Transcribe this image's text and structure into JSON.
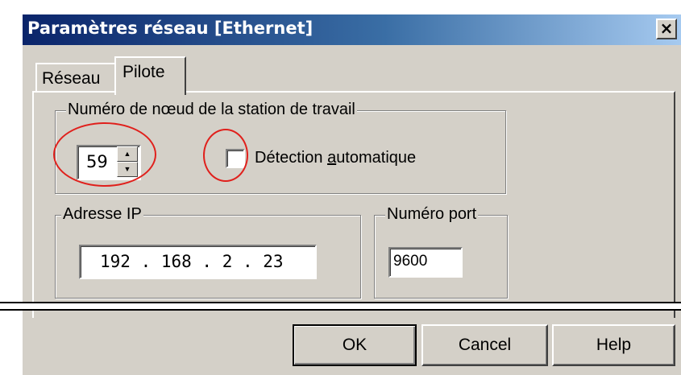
{
  "window": {
    "title": "Paramètres réseau [Ethernet]",
    "close_glyph": "×"
  },
  "tabs": [
    {
      "label": "Réseau",
      "selected": false
    },
    {
      "label": "Pilote",
      "selected": true
    }
  ],
  "node_group": {
    "label": "Numéro de nœud de la station de travail",
    "node_value": "59",
    "auto_detect": {
      "label_prefix": "D",
      "label_mid": "étection ",
      "label_accel": "a",
      "label_rest": "utomatique",
      "checked": false
    }
  },
  "ip_group": {
    "label": "Adresse IP",
    "value": "192 . 168 . 2 . 23"
  },
  "port_group": {
    "label": "Numéro port",
    "value": "9600"
  },
  "buttons": {
    "ok": "OK",
    "cancel": "Cancel",
    "help": "Help"
  },
  "icons": {
    "spin_up": "▲",
    "spin_down": "▼"
  },
  "colors": {
    "title_bar_start": "#0a246a",
    "title_bar_end": "#a6caf0",
    "window_bg": "#d4d0c8",
    "annotation_red": "#e0201c"
  }
}
